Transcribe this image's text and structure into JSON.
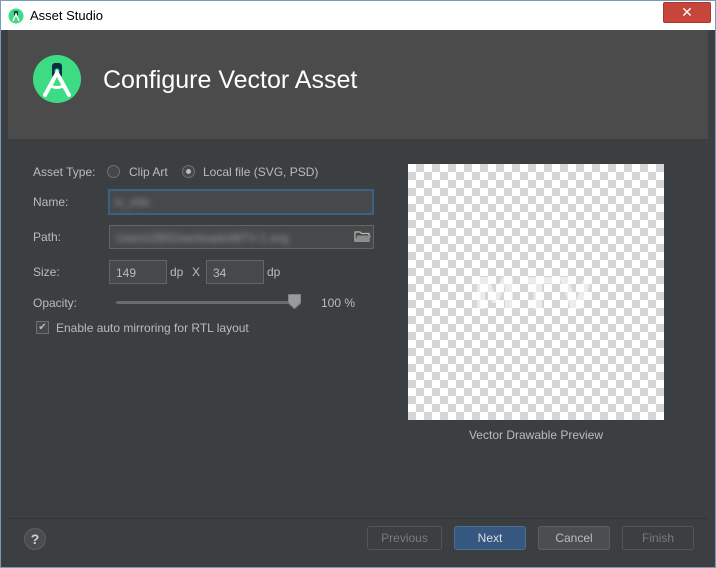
{
  "window": {
    "title": "Asset Studio",
    "close_glyph": "✕"
  },
  "header": {
    "title": "Configure Vector Asset",
    "logo": "android-studio-logo-icon"
  },
  "form": {
    "asset_type_label": "Asset Type:",
    "asset_type_options": [
      {
        "label": "Clip Art",
        "selected": false
      },
      {
        "label": "Local file (SVG, PSD)",
        "selected": true
      }
    ],
    "name_label": "Name:",
    "name_value": "ic_mtv",
    "path_label": "Path:",
    "path_value": "Users\\2B\\Downloads\\MTV-1.svg",
    "size_label": "Size:",
    "width_value": "149",
    "width_unit": "dp",
    "size_separator": "X",
    "height_value": "34",
    "height_unit": "dp",
    "opacity_label": "Opacity:",
    "opacity_value": "100 %",
    "opacity_level": 1.0,
    "rtl_label": "Enable auto mirroring for RTL layout",
    "rtl_checked": true
  },
  "preview": {
    "caption": "Vector Drawable Preview",
    "art_text": "MTV"
  },
  "footer": {
    "help": "?",
    "previous": "Previous",
    "next": "Next",
    "cancel": "Cancel",
    "finish": "Finish"
  },
  "colors": {
    "accent": "#365880",
    "background": "#3c3f41",
    "header": "#4b4b4b",
    "logo_green": "#3ddc84"
  }
}
